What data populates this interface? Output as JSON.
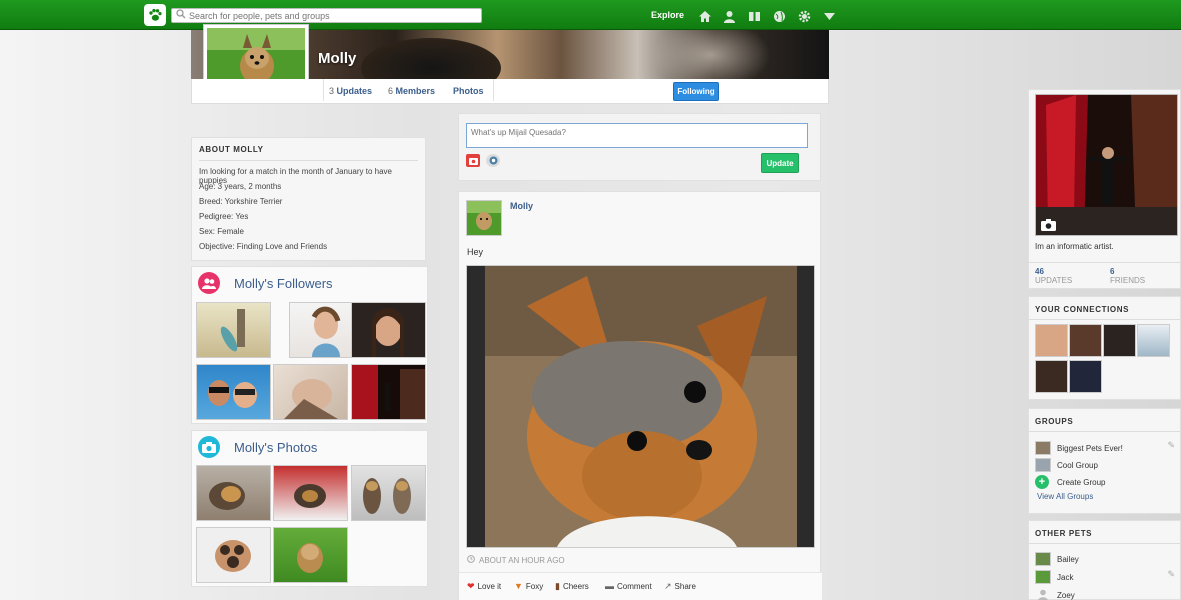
{
  "topbar": {
    "search_placeholder": "Search for people, pets and groups",
    "explore_label": "Explore",
    "icons": [
      "home-icon",
      "user-icon",
      "book-icon",
      "globe-icon",
      "gear-icon",
      "dropdown-icon"
    ]
  },
  "profile": {
    "name": "Molly",
    "tabs": [
      {
        "count": "3",
        "label": "Updates"
      },
      {
        "count": "6",
        "label": "Members"
      },
      {
        "count": "",
        "label": "Photos"
      }
    ],
    "follow_label": "Following"
  },
  "about": {
    "title": "ABOUT MOLLY",
    "lines": [
      "Im looking for a match in the month of January to have puppies",
      "Age: 3 years, 2 months",
      "Breed: Yorkshire Terrier",
      "Pedigree: Yes",
      "Sex: Female",
      "Objective: Finding Love and Friends"
    ]
  },
  "followers": {
    "title": "Molly's Followers"
  },
  "photos": {
    "title": "Molly's Photos"
  },
  "composer": {
    "placeholder": "What's up Mijail Quesada?",
    "update_label": "Update"
  },
  "post": {
    "author": "Molly",
    "text": "Hey",
    "time": "ABOUT AN HOUR AGO",
    "actions": [
      "Love it",
      "Foxy",
      "Cheers",
      "Comment",
      "Share"
    ]
  },
  "user_card": {
    "bio": "Im an informatic artist.",
    "updates_count": "46",
    "updates_label": "UPDATES",
    "friends_count": "6",
    "friends_label": "FRIENDS"
  },
  "connections": {
    "title": "YOUR CONNECTIONS"
  },
  "groups": {
    "title": "GROUPS",
    "items": [
      "Biggest Pets Ever!",
      "Cool Group"
    ],
    "create_label": "Create Group",
    "view_all_label": "View All Groups"
  },
  "other_pets": {
    "title": "OTHER PETS",
    "items": [
      "Bailey",
      "Jack",
      "Zoey"
    ]
  },
  "colors": {
    "topbar_green": "#148a14",
    "link_blue": "#3b5e8c",
    "follow_blue": "#2d8de0",
    "update_green": "#27c06a"
  }
}
